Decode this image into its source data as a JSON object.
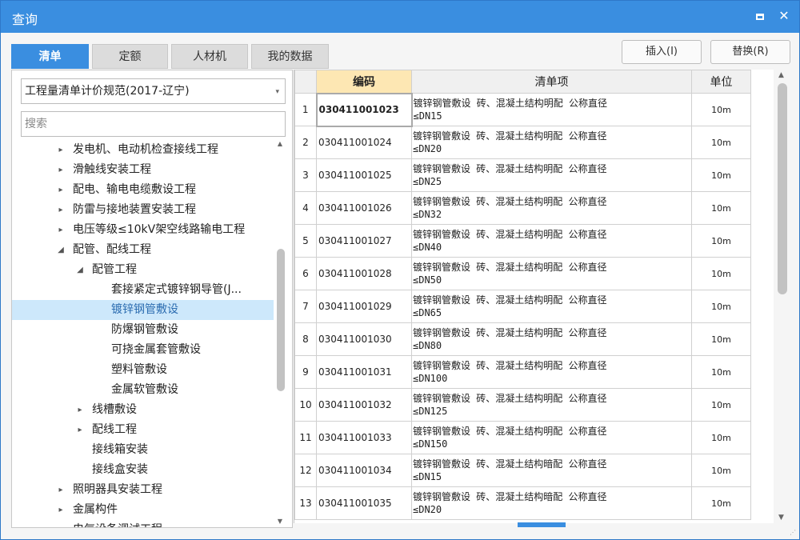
{
  "window": {
    "title": "查询"
  },
  "tabs": [
    "清单",
    "定额",
    "人材机",
    "我的数据"
  ],
  "actions": {
    "insert": "插入(I)",
    "replace": "替换(R)"
  },
  "spec_select": "工程量清单计价规范(2017-辽宁)",
  "search_placeholder": "搜索",
  "tree": [
    {
      "label": "发电机、电动机检查接线工程",
      "level": 1,
      "arrow": "▸"
    },
    {
      "label": "滑触线安装工程",
      "level": 1,
      "arrow": "▸"
    },
    {
      "label": "配电、输电电缆敷设工程",
      "level": 1,
      "arrow": "▸"
    },
    {
      "label": "防雷与接地装置安装工程",
      "level": 1,
      "arrow": "▸"
    },
    {
      "label": "电压等级≤10kV架空线路输电工程",
      "level": 1,
      "arrow": "▸"
    },
    {
      "label": "配管、配线工程",
      "level": 1,
      "arrow": "◢"
    },
    {
      "label": "配管工程",
      "level": 2,
      "arrow": "◢"
    },
    {
      "label": "套接紧定式镀锌钢导管(J...",
      "level": 3,
      "arrow": ""
    },
    {
      "label": "镀锌钢管敷设",
      "level": 3,
      "arrow": "",
      "selected": true
    },
    {
      "label": "防爆钢管敷设",
      "level": 3,
      "arrow": ""
    },
    {
      "label": "可挠金属套管敷设",
      "level": 3,
      "arrow": ""
    },
    {
      "label": "塑料管敷设",
      "level": 3,
      "arrow": ""
    },
    {
      "label": "金属软管敷设",
      "level": 3,
      "arrow": ""
    },
    {
      "label": "线槽敷设",
      "level": 2,
      "arrow": "▸"
    },
    {
      "label": "配线工程",
      "level": 2,
      "arrow": "▸"
    },
    {
      "label": "接线箱安装",
      "level": 2,
      "arrow": ""
    },
    {
      "label": "接线盒安装",
      "level": 2,
      "arrow": ""
    },
    {
      "label": "照明器具安装工程",
      "level": 1,
      "arrow": "▸"
    },
    {
      "label": "金属构件",
      "level": 1,
      "arrow": "▸"
    },
    {
      "label": "电气设备调试工程",
      "level": 1,
      "arrow": "▸"
    }
  ],
  "grid": {
    "headers": {
      "code": "编码",
      "item": "清单项",
      "unit": "单位"
    },
    "rows": [
      {
        "idx": "1",
        "code": "030411001023",
        "item": "镀锌钢管敷设 砖、混凝土结构明配 公称直径\n≤DN15",
        "unit": "10m"
      },
      {
        "idx": "2",
        "code": "030411001024",
        "item": "镀锌钢管敷设 砖、混凝土结构明配 公称直径\n≤DN20",
        "unit": "10m"
      },
      {
        "idx": "3",
        "code": "030411001025",
        "item": "镀锌钢管敷设 砖、混凝土结构明配 公称直径\n≤DN25",
        "unit": "10m"
      },
      {
        "idx": "4",
        "code": "030411001026",
        "item": "镀锌钢管敷设 砖、混凝土结构明配 公称直径\n≤DN32",
        "unit": "10m"
      },
      {
        "idx": "5",
        "code": "030411001027",
        "item": "镀锌钢管敷设 砖、混凝土结构明配 公称直径\n≤DN40",
        "unit": "10m"
      },
      {
        "idx": "6",
        "code": "030411001028",
        "item": "镀锌钢管敷设 砖、混凝土结构明配 公称直径\n≤DN50",
        "unit": "10m"
      },
      {
        "idx": "7",
        "code": "030411001029",
        "item": "镀锌钢管敷设 砖、混凝土结构明配 公称直径\n≤DN65",
        "unit": "10m"
      },
      {
        "idx": "8",
        "code": "030411001030",
        "item": "镀锌钢管敷设 砖、混凝土结构明配 公称直径\n≤DN80",
        "unit": "10m"
      },
      {
        "idx": "9",
        "code": "030411001031",
        "item": "镀锌钢管敷设 砖、混凝土结构明配 公称直径\n≤DN100",
        "unit": "10m"
      },
      {
        "idx": "10",
        "code": "030411001032",
        "item": "镀锌钢管敷设 砖、混凝土结构明配 公称直径\n≤DN125",
        "unit": "10m"
      },
      {
        "idx": "11",
        "code": "030411001033",
        "item": "镀锌钢管敷设 砖、混凝土结构明配 公称直径\n≤DN150",
        "unit": "10m"
      },
      {
        "idx": "12",
        "code": "030411001034",
        "item": "镀锌钢管敷设 砖、混凝土结构暗配 公称直径\n≤DN15",
        "unit": "10m"
      },
      {
        "idx": "13",
        "code": "030411001035",
        "item": "镀锌钢管敷设 砖、混凝土结构暗配 公称直径\n≤DN20",
        "unit": "10m"
      }
    ]
  },
  "colors": {
    "accent": "#3a8ee0",
    "selected_row": "#cde8fb",
    "header_highlight": "#fde7b3"
  }
}
